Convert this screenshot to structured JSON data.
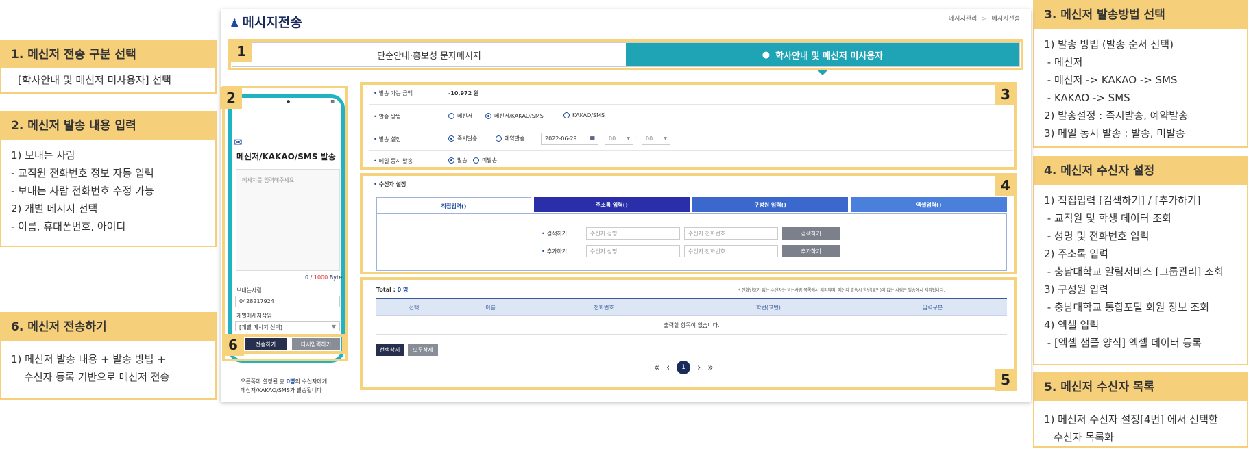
{
  "left": {
    "g1": {
      "title": "1. 메신저 전송 구분 선택",
      "lines": [
        "[학사안내 및 메신저 미사용자] 선택"
      ]
    },
    "g2": {
      "title": "2. 메신저 발송 내용 입력",
      "lines": [
        "1) 보내는 사람",
        " - 교직원 전화번호 정보 자동 입력",
        " - 보내는 사람 전화번호 수정 가능",
        "2) 개별 메시지 선택",
        " - 이름, 휴대폰번호, 아이디"
      ]
    },
    "g6": {
      "title": "6. 메신저 전송하기",
      "lines": [
        "1) 메신저 발송 내용 + 발송 방법 +",
        "    수신자 등록 기반으로 메신저 전송"
      ]
    }
  },
  "right": {
    "g3": {
      "title": "3. 메신저 발송방법 선택",
      "lines": [
        "1) 발송 방법 (발송 순서 선택)",
        " - 메신저",
        " - 메신저 -> KAKAO -> SMS",
        " - KAKAO -> SMS",
        "2) 발송설정 : 즉시발송, 예약발송",
        "3) 메일 동시 발송 : 발송, 미발송"
      ]
    },
    "g4": {
      "title": "4. 메신저 수신자 설정",
      "lines": [
        "1) 직접입력 [검색하기] / [추가하기]",
        " - 교직원 및 학생 데이터 조회",
        " - 성명 및 전화번호 입력",
        "2) 주소록 입력",
        " - 충남대학교 알림서비스 [그룹관리] 조회",
        "3) 구성원 입력",
        " - 충남대학교 통합포털 회원 정보 조회",
        "4) 엑셀 입력",
        " - [엑셀 샘플 양식] 엑셀 데이터 등록"
      ]
    },
    "g5": {
      "title": "5. 메신저 수신자 목록",
      "lines": [
        "1) 메신저 수신자 설정[4번] 에서 선택한",
        "   수신자 목록화"
      ]
    }
  },
  "page": {
    "title": "메시지전송",
    "crumb1": "메시지관리",
    "crumb2": "메시지전송"
  },
  "numbers": {
    "n1": "1",
    "n2": "2",
    "n3": "3",
    "n4": "4",
    "n5": "5",
    "n6": "6"
  },
  "tabs": {
    "t1": "단순안내·홍보성 문자메시지",
    "t2": "학사안내 및 메신저 미사용자"
  },
  "phone": {
    "title": "메신저/KAKAO/SMS 발송",
    "placeholder": "메세지를 입력해주세요.",
    "byte_current": "0",
    "byte_sep": " / ",
    "byte_max": "1000",
    "byte_unit": " Byte",
    "sender_label": "보내는사람",
    "sender_value": "0428217924",
    "indiv_label": "개별메세지삽입",
    "indiv_value": "[개별 메시지 선택]",
    "send_btn": "전송하기",
    "reset_btn": "다시입력하기",
    "note1_pre": "오른쪽에 설정된 총 ",
    "note1_count": "0명",
    "note1_post": "의 수신자에게",
    "note2": "메신저/KAKAO/SMS가 발송됩니다"
  },
  "form": {
    "amount_label": "발송 가능 금액",
    "amount_value": "-10,972 원",
    "method_label": "발송 방법",
    "method_opts": [
      "메신저",
      "메신저/KAKAO/SMS",
      "KAKAO/SMS"
    ],
    "set_label": "발송 설정",
    "set_opts": [
      "즉시발송",
      "예약발송"
    ],
    "date": "2022-06-29",
    "hour": "00",
    "min": "00",
    "mail_label": "메일 동시 발송",
    "mail_opts": [
      "발송",
      "미발송"
    ]
  },
  "receiver": {
    "label": "수신자 설정",
    "tabs": [
      "직접입력()",
      "주소록 입력()",
      "구성원 입력()",
      "엑셀입력()"
    ],
    "search_label": "검색하기",
    "add_label": "추가하기",
    "name_ph": "수신자 성명",
    "phone_ph": "수신자 전화번호",
    "search_btn": "검색하기",
    "add_btn": "추가하기"
  },
  "list": {
    "total_label": "Total : ",
    "total_value": "0 명",
    "notice": "* 전화번호가 없는 수신자는 받는사람 목록에서 제외되며, 메신저 발송시 학번(교번)이 없는 사람은 발송에서 제외됩니다.",
    "headers": [
      "선택",
      "이름",
      "전화번호",
      "학번(교번)",
      "입력구분"
    ],
    "empty": "출력할 항목이 없습니다.",
    "del_sel": "선택삭제",
    "del_all": "모두삭제",
    "pager": {
      "first": "«",
      "prev": "‹",
      "page": "1",
      "next": "›",
      "last": "»"
    }
  }
}
